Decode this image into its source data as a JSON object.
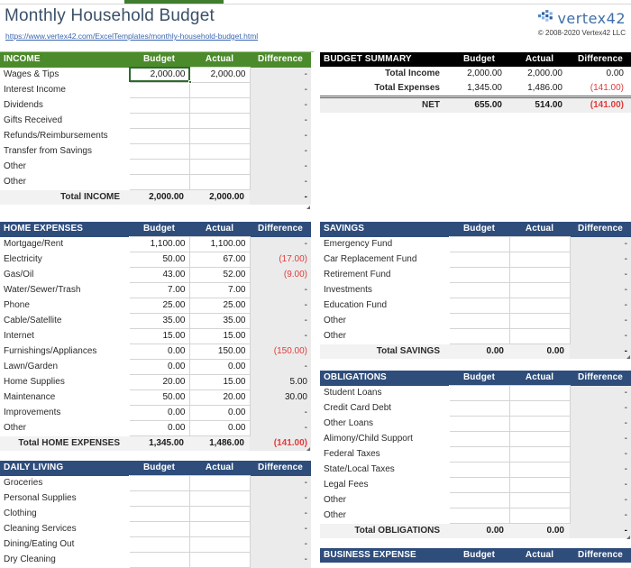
{
  "header": {
    "title": "Monthly Household Budget",
    "link": "https://www.vertex42.com/ExcelTemplates/monthly-household-budget.html",
    "brand_name": "vertex42",
    "copyright": "© 2008-2020 Vertex42 LLC"
  },
  "column_headers": {
    "budget": "Budget",
    "actual": "Actual",
    "difference": "Difference"
  },
  "income": {
    "title": "INCOME",
    "rows": [
      {
        "label": "Wages & Tips",
        "budget": "2,000.00",
        "actual": "2,000.00",
        "difference": "-",
        "negative": false
      },
      {
        "label": "Interest Income",
        "budget": "",
        "actual": "",
        "difference": "-",
        "negative": false
      },
      {
        "label": "Dividends",
        "budget": "",
        "actual": "",
        "difference": "-",
        "negative": false
      },
      {
        "label": "Gifts Received",
        "budget": "",
        "actual": "",
        "difference": "-",
        "negative": false
      },
      {
        "label": "Refunds/Reimbursements",
        "budget": "",
        "actual": "",
        "difference": "-",
        "negative": false
      },
      {
        "label": "Transfer from Savings",
        "budget": "",
        "actual": "",
        "difference": "-",
        "negative": false
      },
      {
        "label": "Other",
        "budget": "",
        "actual": "",
        "difference": "-",
        "negative": false
      },
      {
        "label": "Other",
        "budget": "",
        "actual": "",
        "difference": "-",
        "negative": false
      }
    ],
    "total": {
      "label": "Total INCOME",
      "budget": "2,000.00",
      "actual": "2,000.00",
      "difference": "-",
      "negative": false
    }
  },
  "summary": {
    "title": "BUDGET SUMMARY",
    "rows": [
      {
        "label": "Total Income",
        "budget": "2,000.00",
        "actual": "2,000.00",
        "difference": "0.00",
        "negative": false
      },
      {
        "label": "Total Expenses",
        "budget": "1,345.00",
        "actual": "1,486.00",
        "difference": "(141.00)",
        "negative": true
      }
    ],
    "net": {
      "label": "NET",
      "budget": "655.00",
      "actual": "514.00",
      "difference": "(141.00)",
      "negative": true
    }
  },
  "home_expenses": {
    "title": "HOME EXPENSES",
    "rows": [
      {
        "label": "Mortgage/Rent",
        "budget": "1,100.00",
        "actual": "1,100.00",
        "difference": "-",
        "negative": false
      },
      {
        "label": "Electricity",
        "budget": "50.00",
        "actual": "67.00",
        "difference": "(17.00)",
        "negative": true
      },
      {
        "label": "Gas/Oil",
        "budget": "43.00",
        "actual": "52.00",
        "difference": "(9.00)",
        "negative": true
      },
      {
        "label": "Water/Sewer/Trash",
        "budget": "7.00",
        "actual": "7.00",
        "difference": "-",
        "negative": false
      },
      {
        "label": "Phone",
        "budget": "25.00",
        "actual": "25.00",
        "difference": "-",
        "negative": false
      },
      {
        "label": "Cable/Satellite",
        "budget": "35.00",
        "actual": "35.00",
        "difference": "-",
        "negative": false
      },
      {
        "label": "Internet",
        "budget": "15.00",
        "actual": "15.00",
        "difference": "-",
        "negative": false
      },
      {
        "label": "Furnishings/Appliances",
        "budget": "0.00",
        "actual": "150.00",
        "difference": "(150.00)",
        "negative": true
      },
      {
        "label": "Lawn/Garden",
        "budget": "0.00",
        "actual": "0.00",
        "difference": "-",
        "negative": false
      },
      {
        "label": "Home Supplies",
        "budget": "20.00",
        "actual": "15.00",
        "difference": "5.00",
        "negative": false
      },
      {
        "label": "Maintenance",
        "budget": "50.00",
        "actual": "20.00",
        "difference": "30.00",
        "negative": false
      },
      {
        "label": "Improvements",
        "budget": "0.00",
        "actual": "0.00",
        "difference": "-",
        "negative": false
      },
      {
        "label": "Other",
        "budget": "0.00",
        "actual": "0.00",
        "difference": "-",
        "negative": false
      }
    ],
    "total": {
      "label": "Total HOME EXPENSES",
      "budget": "1,345.00",
      "actual": "1,486.00",
      "difference": "(141.00)",
      "negative": true
    }
  },
  "daily_living": {
    "title": "DAILY LIVING",
    "rows": [
      {
        "label": "Groceries",
        "budget": "",
        "actual": "",
        "difference": "-",
        "negative": false
      },
      {
        "label": "Personal Supplies",
        "budget": "",
        "actual": "",
        "difference": "-",
        "negative": false
      },
      {
        "label": "Clothing",
        "budget": "",
        "actual": "",
        "difference": "-",
        "negative": false
      },
      {
        "label": "Cleaning Services",
        "budget": "",
        "actual": "",
        "difference": "-",
        "negative": false
      },
      {
        "label": "Dining/Eating Out",
        "budget": "",
        "actual": "",
        "difference": "-",
        "negative": false
      },
      {
        "label": "Dry Cleaning",
        "budget": "",
        "actual": "",
        "difference": "-",
        "negative": false
      }
    ]
  },
  "savings": {
    "title": "SAVINGS",
    "rows": [
      {
        "label": "Emergency Fund",
        "budget": "",
        "actual": "",
        "difference": "-",
        "negative": false
      },
      {
        "label": "Car Replacement Fund",
        "budget": "",
        "actual": "",
        "difference": "-",
        "negative": false
      },
      {
        "label": "Retirement Fund",
        "budget": "",
        "actual": "",
        "difference": "-",
        "negative": false
      },
      {
        "label": "Investments",
        "budget": "",
        "actual": "",
        "difference": "-",
        "negative": false
      },
      {
        "label": "Education Fund",
        "budget": "",
        "actual": "",
        "difference": "-",
        "negative": false
      },
      {
        "label": "Other",
        "budget": "",
        "actual": "",
        "difference": "-",
        "negative": false
      },
      {
        "label": "Other",
        "budget": "",
        "actual": "",
        "difference": "-",
        "negative": false
      }
    ],
    "total": {
      "label": "Total SAVINGS",
      "budget": "0.00",
      "actual": "0.00",
      "difference": "-",
      "negative": false
    }
  },
  "obligations": {
    "title": "OBLIGATIONS",
    "rows": [
      {
        "label": "Student Loans",
        "budget": "",
        "actual": "",
        "difference": "-",
        "negative": false
      },
      {
        "label": "Credit Card Debt",
        "budget": "",
        "actual": "",
        "difference": "-",
        "negative": false
      },
      {
        "label": "Other Loans",
        "budget": "",
        "actual": "",
        "difference": "-",
        "negative": false
      },
      {
        "label": "Alimony/Child Support",
        "budget": "",
        "actual": "",
        "difference": "-",
        "negative": false
      },
      {
        "label": "Federal Taxes",
        "budget": "",
        "actual": "",
        "difference": "-",
        "negative": false
      },
      {
        "label": "State/Local Taxes",
        "budget": "",
        "actual": "",
        "difference": "-",
        "negative": false
      },
      {
        "label": "Legal Fees",
        "budget": "",
        "actual": "",
        "difference": "-",
        "negative": false
      },
      {
        "label": "Other",
        "budget": "",
        "actual": "",
        "difference": "-",
        "negative": false
      },
      {
        "label": "Other",
        "budget": "",
        "actual": "",
        "difference": "-",
        "negative": false
      }
    ],
    "total": {
      "label": "Total OBLIGATIONS",
      "budget": "0.00",
      "actual": "0.00",
      "difference": "-",
      "negative": false
    }
  },
  "business_expense": {
    "title": "BUSINESS EXPENSE"
  },
  "colors": {
    "income_header": "#4c8b2b",
    "section_header": "#2e4d7b",
    "summary_header": "#000000",
    "negative": "#e03b3b",
    "difference_bg": "#ebebeb",
    "selection": "#2d6b2d"
  }
}
